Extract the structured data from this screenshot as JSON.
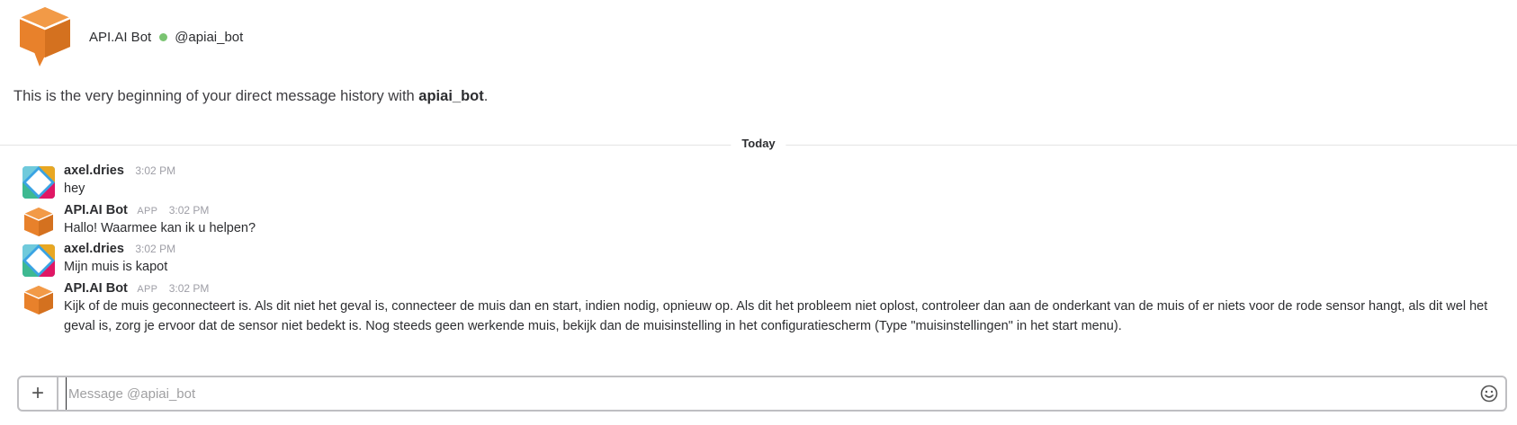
{
  "header": {
    "bot_name": "API.AI Bot",
    "handle": "@apiai_bot",
    "presence_color": "#7ac472"
  },
  "intro": {
    "text": "This is the very beginning of your direct message history with",
    "name": "apiai_bot",
    "suffix": "."
  },
  "divider": {
    "label": "Today"
  },
  "messages": [
    {
      "author": "axel.dries",
      "badge": "",
      "time": "3:02 PM",
      "text": "hey",
      "avatar": "user-avatar-icon"
    },
    {
      "author": "API.AI Bot",
      "badge": "APP",
      "time": "3:02 PM",
      "text": "Hallo! Waarmee kan ik u helpen?",
      "avatar": "bot-avatar-icon"
    },
    {
      "author": "axel.dries",
      "badge": "",
      "time": "3:02 PM",
      "text": "Mijn muis is kapot",
      "avatar": "user-avatar-icon"
    },
    {
      "author": "API.AI Bot",
      "badge": "APP",
      "time": "3:02 PM",
      "text": "Kijk of de muis geconnecteert is. Als dit niet het geval is, connecteer de muis dan en start, indien nodig, opnieuw op. Als dit het probleem niet oplost, controleer dan aan de onderkant van de muis of er niets voor de rode sensor hangt, als dit wel het geval is, zorg je ervoor dat de sensor niet bedekt is. Nog steeds geen werkende muis, bekijk dan de muisinstelling in het configuratiescherm (Type \"muisinstellingen\" in het start menu).",
      "avatar": "bot-avatar-icon"
    }
  ],
  "composer": {
    "plus": "+",
    "placeholder": "Message @apiai_bot",
    "value": ""
  },
  "colors": {
    "bot_orange": "#e8812b",
    "bot_orange_dark": "#c96a1d"
  }
}
